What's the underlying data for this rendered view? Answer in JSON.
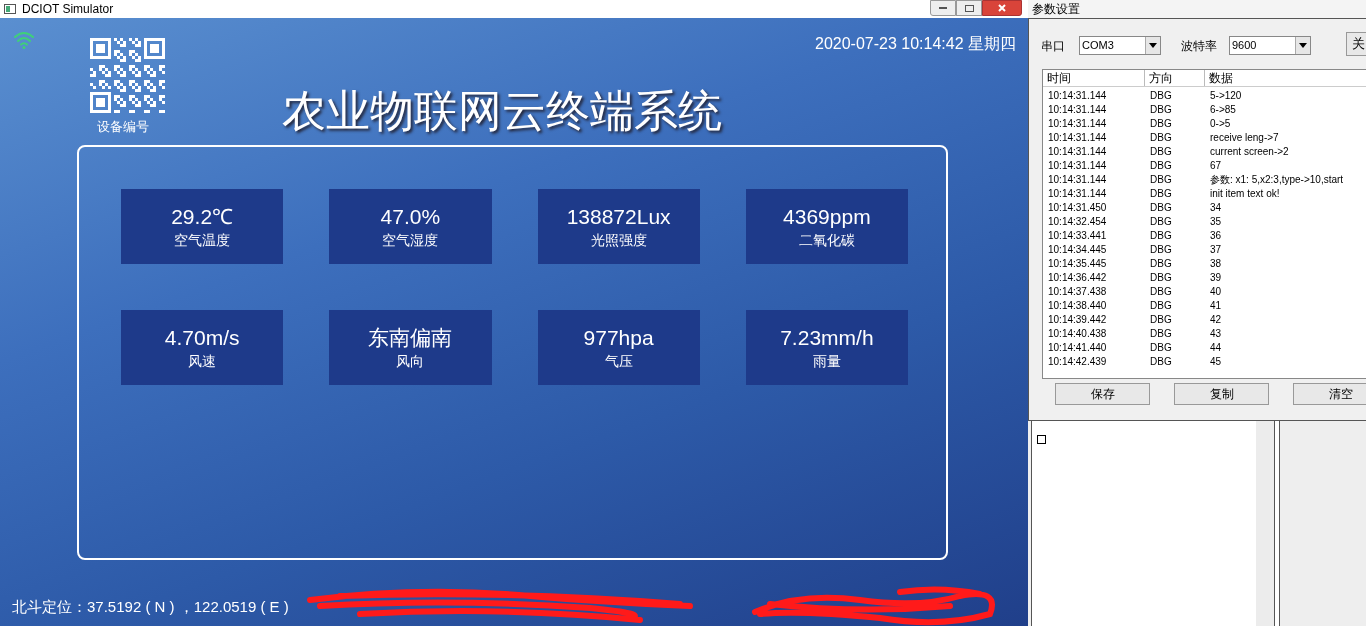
{
  "window": {
    "title": "DCIOT Simulator"
  },
  "header": {
    "qr_label": "设备编号",
    "datetime": "2020-07-23 10:14:42 星期四",
    "title": "农业物联网云终端系统"
  },
  "sensors": [
    {
      "value": "29.2℃",
      "label": "空气温度"
    },
    {
      "value": "47.0%",
      "label": "空气湿度"
    },
    {
      "value": "138872Lux",
      "label": "光照强度"
    },
    {
      "value": "4369ppm",
      "label": "二氧化碳"
    },
    {
      "value": "4.70m/s",
      "label": "风速"
    },
    {
      "value": "东南偏南",
      "label": "风向"
    },
    {
      "value": "977hpa",
      "label": "气压"
    },
    {
      "value": "7.23mm/h",
      "label": "雨量"
    }
  ],
  "footer": {
    "location": "北斗定位：37.5192 ( N ) ，122.0519 ( E )"
  },
  "settings_dialog": {
    "title": "参数设置",
    "port_label": "串口",
    "port": "COM3",
    "baud_label": "波特率",
    "baud": "9600",
    "action_button": "关",
    "log": {
      "columns": [
        "时间",
        "方向",
        "数据"
      ],
      "rows": [
        [
          "10:14:31.144",
          "DBG",
          "5->120"
        ],
        [
          "10:14:31.144",
          "DBG",
          "6->85"
        ],
        [
          "10:14:31.144",
          "DBG",
          "0->5"
        ],
        [
          "10:14:31.144",
          "DBG",
          "receive leng->7"
        ],
        [
          "10:14:31.144",
          "DBG",
          "current screen->2"
        ],
        [
          "10:14:31.144",
          "DBG",
          "67"
        ],
        [
          "10:14:31.144",
          "DBG",
          "参数: x1: 5,x2:3,type->10,start"
        ],
        [
          "10:14:31.144",
          "DBG",
          "init item text ok!"
        ],
        [
          "10:14:31.450",
          "DBG",
          "34"
        ],
        [
          "10:14:32.454",
          "DBG",
          "35"
        ],
        [
          "10:14:33.441",
          "DBG",
          "36"
        ],
        [
          "10:14:34.445",
          "DBG",
          "37"
        ],
        [
          "10:14:35.445",
          "DBG",
          "38"
        ],
        [
          "10:14:36.442",
          "DBG",
          "39"
        ],
        [
          "10:14:37.438",
          "DBG",
          "40"
        ],
        [
          "10:14:38.440",
          "DBG",
          "41"
        ],
        [
          "10:14:39.442",
          "DBG",
          "42"
        ],
        [
          "10:14:40.438",
          "DBG",
          "43"
        ],
        [
          "10:14:41.440",
          "DBG",
          "44"
        ],
        [
          "10:14:42.439",
          "DBG",
          "45"
        ]
      ]
    },
    "buttons": [
      "保存",
      "复制",
      "清空"
    ]
  },
  "checkbox": {
    "checked": false
  }
}
